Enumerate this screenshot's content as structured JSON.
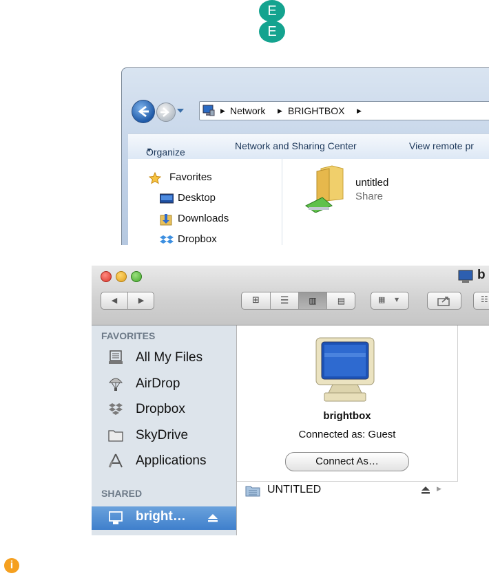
{
  "logo": {
    "letter_top": "E",
    "letter_bottom": "E",
    "color": "#14a38f"
  },
  "windows_explorer": {
    "breadcrumb": [
      "Network",
      "BRIGHTBOX"
    ],
    "toolbar": {
      "organize": "Organize",
      "network_sharing": "Network and Sharing Center",
      "view_remote": "View remote pr"
    },
    "nav": [
      {
        "label": "Favorites",
        "icon": "star-icon"
      },
      {
        "label": "Desktop",
        "icon": "desktop-icon"
      },
      {
        "label": "Downloads",
        "icon": "downloads-icon"
      },
      {
        "label": "Dropbox",
        "icon": "dropbox-icon"
      }
    ],
    "share": {
      "name": "untitled",
      "type": "Share"
    }
  },
  "mac_finder": {
    "window_title": "b",
    "sidebar": {
      "favorites_header": "FAVORITES",
      "favorites": [
        {
          "label": "All My Files",
          "icon": "all-files-icon"
        },
        {
          "label": "AirDrop",
          "icon": "airdrop-icon"
        },
        {
          "label": "Dropbox",
          "icon": "dropbox-icon"
        },
        {
          "label": "SkyDrive",
          "icon": "folder-icon"
        },
        {
          "label": "Applications",
          "icon": "applications-icon"
        }
      ],
      "shared_header": "SHARED",
      "shared": [
        {
          "label": "bright…",
          "icon": "computer-icon",
          "selected": true
        }
      ]
    },
    "server": {
      "name": "brightbox",
      "status": "Connected as: Guest",
      "connect_button": "Connect As…"
    },
    "volumes": [
      {
        "label": "UNTITLED"
      }
    ]
  },
  "info_icon": {
    "glyph": "i",
    "color": "#f5a020"
  }
}
